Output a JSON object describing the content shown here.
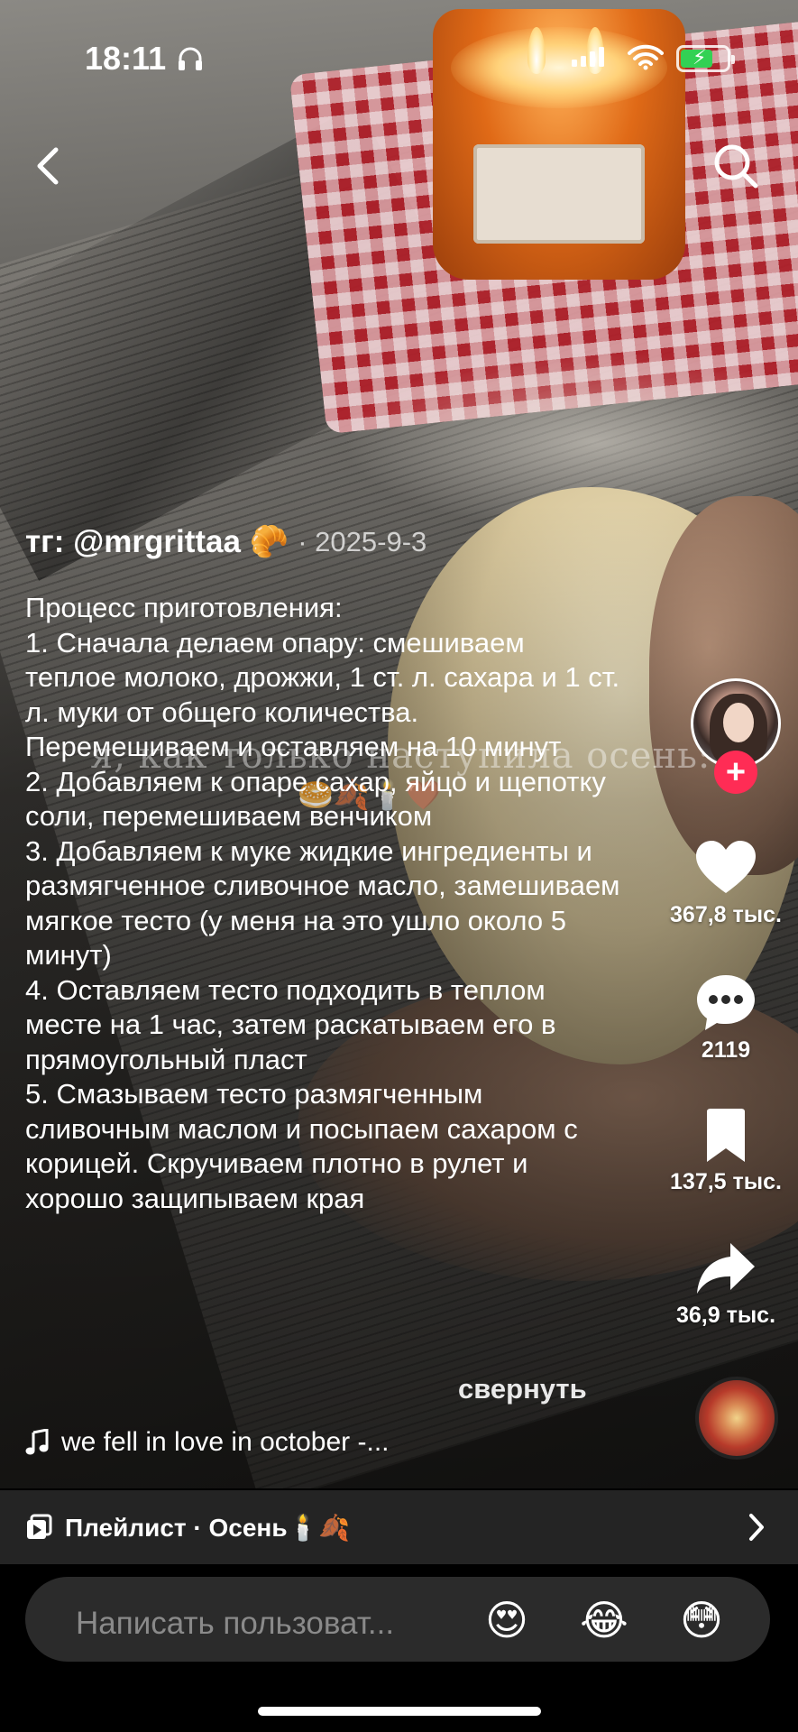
{
  "status_bar": {
    "time": "18:11",
    "icons": [
      "headphones-icon",
      "cellular-signal-icon",
      "wifi-icon",
      "battery-charging-icon"
    ],
    "battery_level": 0.7,
    "battery_color": "#33d154"
  },
  "nav": {
    "back_icon": "chevron-left-icon",
    "search_icon": "search-icon"
  },
  "video": {
    "overlay_caption": "я, как только наступила осень:",
    "overlay_emojis": "🥯🍂🕯️🤎"
  },
  "post": {
    "author": "тг: @mrgrittaa 🥐",
    "date": "· 2025-9-3",
    "caption": "Процесс приготовления:\n1. Сначала делаем опару: смешиваем теплое молоко, дрожжи, 1 ст. л. сахара и 1 ст. л. муки от общего количества. Перемешиваем и оставляем на 10 минут\n2. Добавляем к опаре сахар, яйцо и щепотку соли, перемешиваем венчиком\n3. Добавляем к муке жидкие ингредиенты и размягченное сливочное масло, замешиваем мягкое тесто (у меня на это ушло около 5 минут)\n4. Оставляем тесто подходить в теплом месте на 1 час, затем раскатываем его в прямоугольный пласт\n5. Смазываем тесто размягченным сливочным маслом и посыпаем сахаром с корицей. Скручиваем плотно в рулет и хорошо защипываем края",
    "collapse_label": "свернуть",
    "music": "we fell in love in october -..."
  },
  "actions": {
    "follow_label": "+",
    "likes": "367,8 тыс.",
    "comments": "2119",
    "saves": "137,5 тыс.",
    "shares": "36,9 тыс.",
    "accent_color": "#ff2c55"
  },
  "playlist": {
    "label": "Плейлист · Осень🕯️🍂"
  },
  "comment_bar": {
    "placeholder": "Написать пользоват...",
    "emojis": [
      "😍",
      "😂",
      "😳"
    ]
  }
}
